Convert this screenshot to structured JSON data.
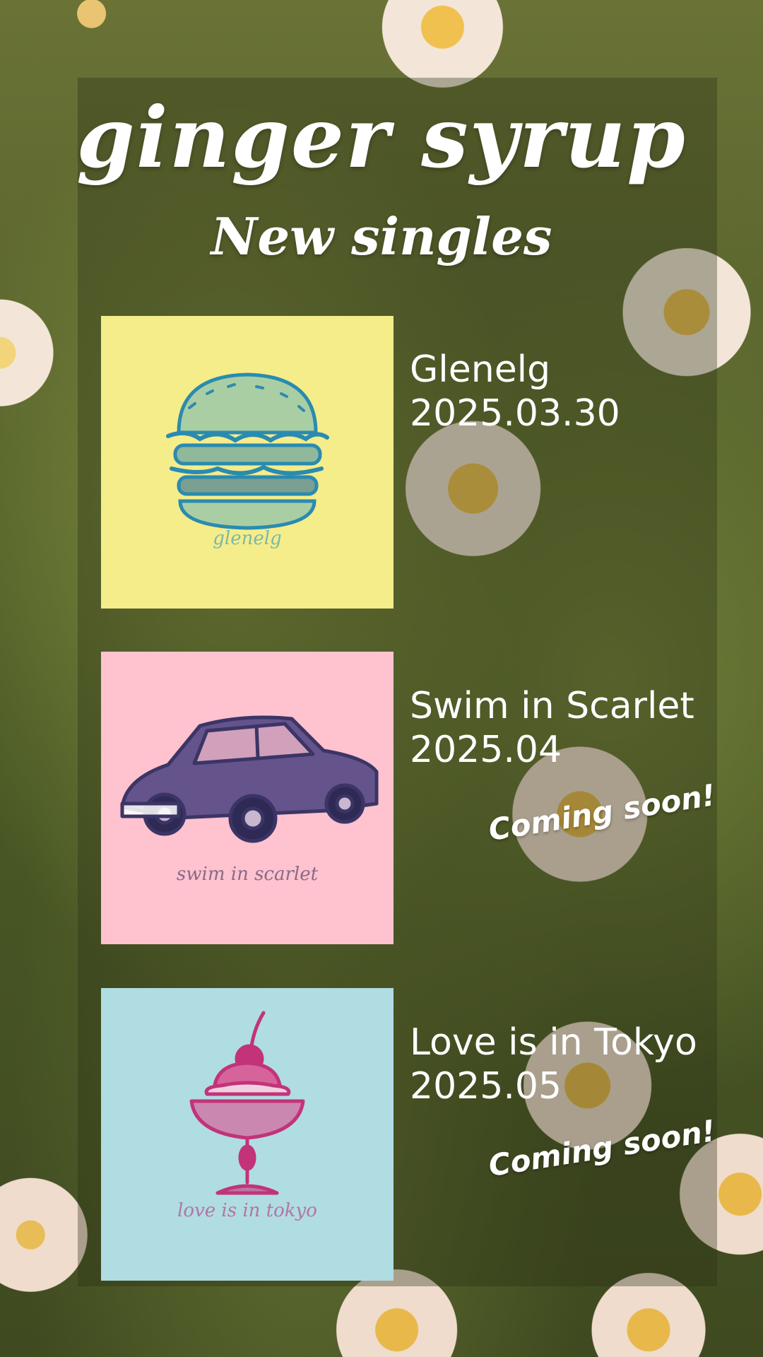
{
  "header": {
    "artist": "ginger syrup",
    "subtitle": "New singles"
  },
  "singles": [
    {
      "title": "Glenelg",
      "date": "2025.03.30",
      "cover_text": "glenelg",
      "cover_color": "#f5ec8a",
      "art_color": "#2a8bb0",
      "art": "hamburger-illustration",
      "status": ""
    },
    {
      "title": "Swim in Scarlet",
      "date": "2025.04",
      "cover_text": "swim in scarlet",
      "cover_color": "#ffc2cf",
      "art_color": "#3b3566",
      "art": "vintage-car-illustration",
      "status": "Coming soon!"
    },
    {
      "title": "Love is in Tokyo",
      "date": "2025.05",
      "cover_text": "love is in tokyo",
      "cover_color": "#b0dde2",
      "art_color": "#c2337a",
      "art": "pudding-sundae-illustration",
      "status": "Coming soon!"
    }
  ]
}
